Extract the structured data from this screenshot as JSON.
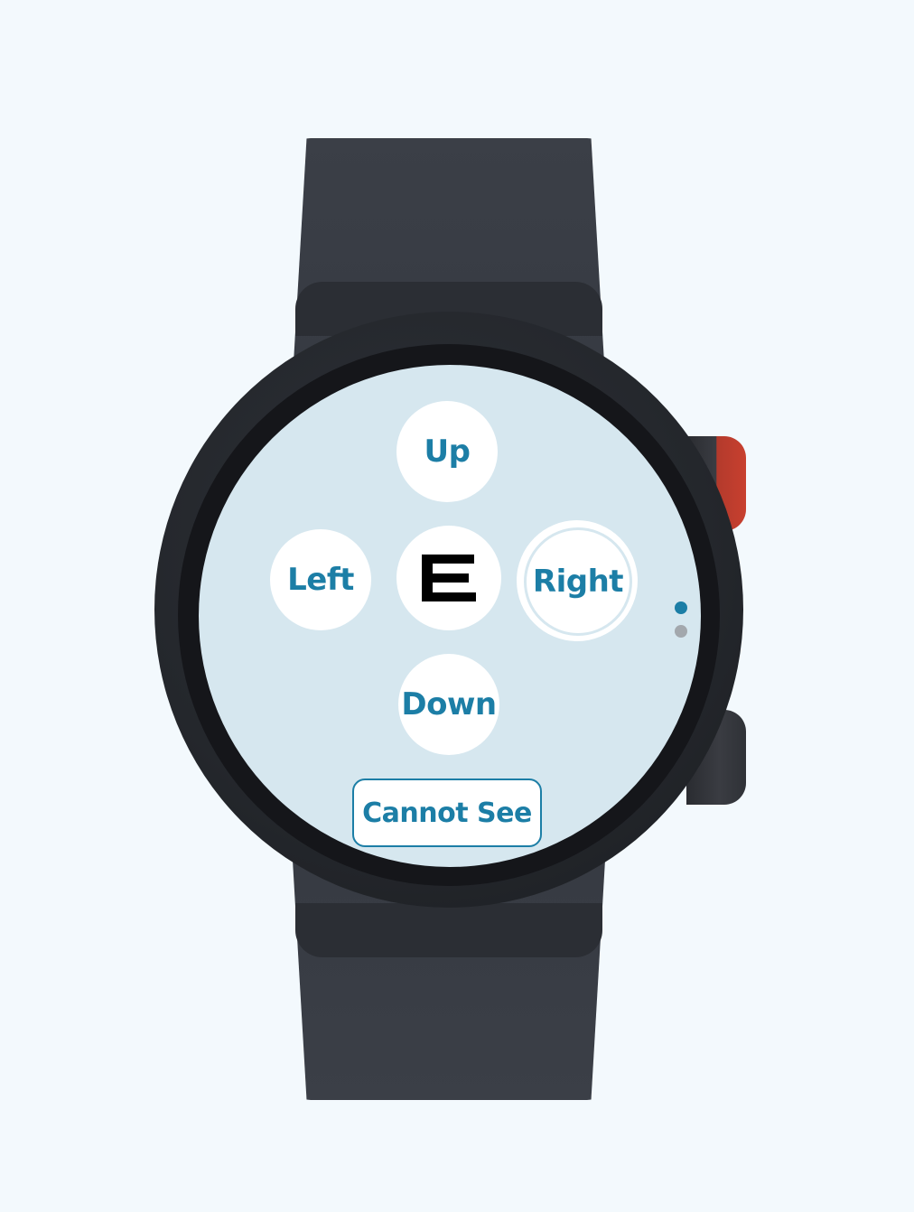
{
  "controls": {
    "up_label": "Up",
    "left_label": "Left",
    "right_label": "Right",
    "down_label": "Down",
    "cannot_see_label": "Cannot See"
  },
  "optotype": {
    "letter": "E",
    "orientation": "right"
  },
  "selected_option": "Right",
  "pager": {
    "pages": 2,
    "current_page": 1
  },
  "colors": {
    "accent": "#1c7ea6",
    "screen_background": "#d6e7ef",
    "button_background": "#ffffff",
    "active_dot": "#1c7ea6",
    "inactive_dot": "#a3a8ad",
    "watch_body": "#393d45",
    "side_button_accent": "#c8402f"
  },
  "icons": {
    "optotype_icon": "tumbling-e-icon"
  }
}
